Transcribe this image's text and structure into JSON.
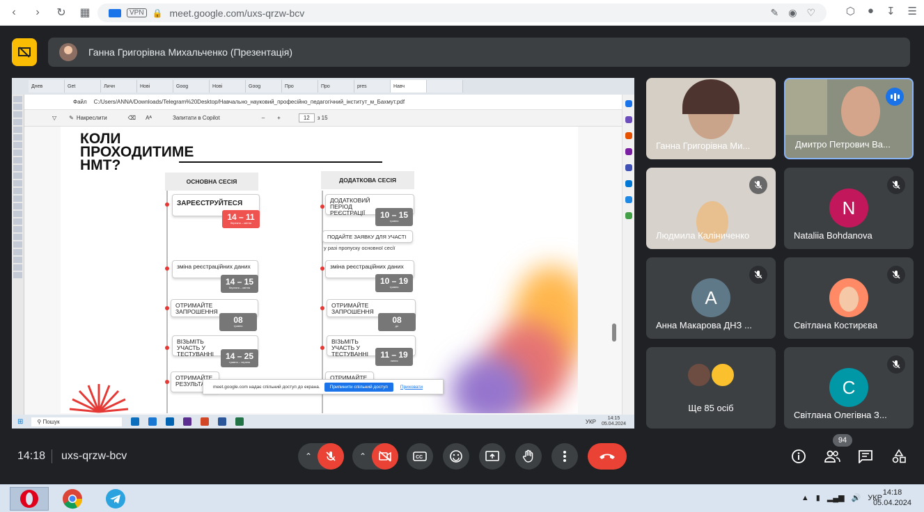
{
  "browser": {
    "url": "meet.google.com/uxs-qrzw-bcv",
    "vpn_label": "VPN"
  },
  "meet": {
    "presenter_bar_title": "Ганна Григорівна Михальченко (Презентація)",
    "time": "14:18",
    "meeting_code": "uxs-qrzw-bcv",
    "participant_count": "94"
  },
  "tiles": [
    {
      "name": "Ганна Григорівна Ми...",
      "type": "video",
      "muted": false
    },
    {
      "name": "Дмитро Петрович Ва...",
      "type": "video",
      "muted": false,
      "speaking": true
    },
    {
      "name": "Людмила Каліниченко",
      "type": "video",
      "muted": true
    },
    {
      "name": "Nataliia Bohdanova",
      "type": "avatar",
      "initial": "N",
      "color": "#c2185b",
      "muted": true
    },
    {
      "name": "Анна Макарова ДНЗ ...",
      "type": "avatar",
      "initial": "A",
      "color": "#5f7989",
      "muted": true
    },
    {
      "name": "Світлана Костирєва",
      "type": "photo",
      "muted": true
    },
    {
      "name": "Ще 85 осіб",
      "type": "group",
      "muted": false
    },
    {
      "name": "Світлана Олегівна З...",
      "type": "avatar",
      "initial": "С",
      "color": "#0097a7",
      "muted": true
    }
  ],
  "shared_screen": {
    "tabs": [
      "Днев",
      "Get",
      "Личн",
      "Нові",
      "Goog",
      "Нові",
      "Goog",
      "Про",
      "Про",
      "pres",
      "Навч",
      ""
    ],
    "file_label": "Файл",
    "file_path": "C:/Users/ANNA/Downloads/Telegram%20Desktop/Навчально_науковий_професійно_педагогічний_інститут_м_Бахмут.pdf",
    "toolbar_draw": "Накреслити",
    "toolbar_aa": "Aᴬ",
    "toolbar_copilot": "Запитати в Copilot",
    "page_current": "12",
    "page_total": "з 15",
    "pdf": {
      "title_lines": [
        "КОЛИ",
        "ПРОХОДИТИМЕ",
        "НМТ?"
      ],
      "main_session": "ОСНОВНА СЕСІЯ",
      "extra_session": "ДОДАТКОВА СЕСІЯ",
      "main_items": [
        {
          "label": "ЗАРЕЄСТРУЙТЕСЯ",
          "date": "14 – 11",
          "sub": "березня – квітня"
        },
        {
          "label": "зміна реєстраційних даних",
          "date": "14 – 15",
          "sub": "березня – квітня"
        },
        {
          "label": "ОТРИМАЙТЕ ЗАПРОШЕННЯ",
          "date": "08",
          "sub": "травня"
        },
        {
          "label": "ВІЗЬМІТЬ УЧАСТЬ У ТЕСТУВАННІ",
          "date": "14 – 25",
          "sub": "травня – червня"
        },
        {
          "label": "ОТРИМАЙТЕ РЕЗУЛЬТА..."
        }
      ],
      "extra_items": [
        {
          "label": "ДОДАТКОВИЙ ПЕРІОД РЕЄСТРАЦІЇ",
          "date": "10 – 15",
          "sub": "травня"
        },
        {
          "label": "ПОДАЙТЕ ЗАЯВКУ ДЛЯ УЧАСТІ",
          "note": "у разі пропуску основної сесії"
        },
        {
          "label": "зміна реєстраційних даних",
          "date": "10 – 19",
          "sub": "травня"
        },
        {
          "label": "ОТРИМАЙТЕ ЗАПРОШЕННЯ",
          "date": "08",
          "sub": "до"
        },
        {
          "label": "ВІЗЬМІТЬ УЧАСТЬ У ТЕСТУВАННІ",
          "date": "11 – 19",
          "sub": "липня"
        },
        {
          "label": "ОТРИМАЙТЕ..."
        }
      ]
    },
    "share_notice": "meet.google.com надає спільний доступ до екрана.",
    "share_stop": "Припинити спільний доступ",
    "share_hide": "Приховати",
    "taskbar_search": "Пошук",
    "taskbar_lang": "УКР",
    "taskbar_time": "14:15",
    "taskbar_date": "05.04.2024"
  },
  "os": {
    "lang": "УКР",
    "time": "14:18",
    "date": "05.04.2024"
  },
  "colors": {
    "meet_bg": "#202124",
    "tile_bg": "#3c4043",
    "accent_red": "#ea4335",
    "presenting_yellow": "#fbbc04"
  }
}
